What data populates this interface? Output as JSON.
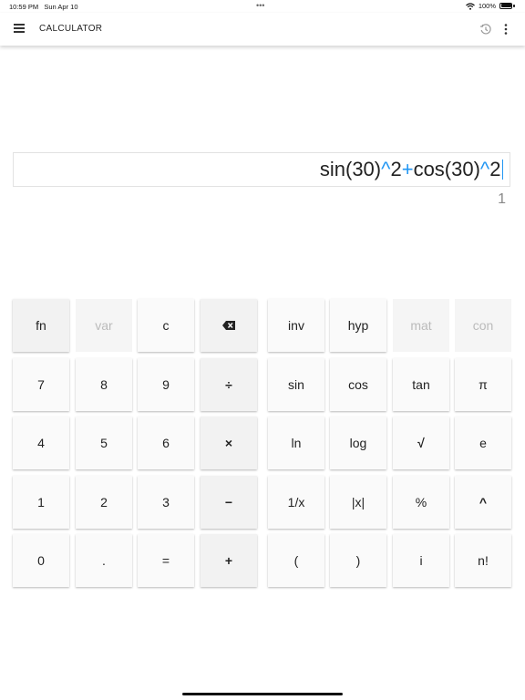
{
  "status_bar": {
    "time": "10:59 PM",
    "date": "Sun Apr 10",
    "dots": "•••",
    "battery": "100%"
  },
  "app_bar": {
    "title": "CALCULATOR",
    "icons": [
      "menu-icon",
      "history-icon",
      "more-vert-icon"
    ]
  },
  "display": {
    "expression": {
      "p1": "sin(30)",
      "op1": "^",
      "p2": "2",
      "op2": "+",
      "p3": "cos(30)",
      "op3": "^",
      "p4": "2"
    },
    "result": "1"
  },
  "keypad": {
    "left": [
      [
        {
          "label": "fn"
        },
        {
          "label": "var"
        },
        {
          "label": "c"
        },
        {
          "label": "",
          "icon": "backspace-icon"
        }
      ],
      [
        {
          "label": "7"
        },
        {
          "label": "8"
        },
        {
          "label": "9"
        },
        {
          "label": "÷"
        }
      ],
      [
        {
          "label": "4"
        },
        {
          "label": "5"
        },
        {
          "label": "6"
        },
        {
          "label": "×"
        }
      ],
      [
        {
          "label": "1"
        },
        {
          "label": "2"
        },
        {
          "label": "3"
        },
        {
          "label": "−"
        }
      ],
      [
        {
          "label": "0"
        },
        {
          "label": "."
        },
        {
          "label": "="
        },
        {
          "label": "+"
        }
      ]
    ],
    "right": [
      [
        {
          "label": "inv"
        },
        {
          "label": "hyp"
        },
        {
          "label": "mat"
        },
        {
          "label": "con"
        }
      ],
      [
        {
          "label": "sin"
        },
        {
          "label": "cos"
        },
        {
          "label": "tan"
        },
        {
          "label": "π"
        }
      ],
      [
        {
          "label": "ln"
        },
        {
          "label": "log"
        },
        {
          "label": "√"
        },
        {
          "label": "e"
        }
      ],
      [
        {
          "label": "1/x"
        },
        {
          "label": "|x|"
        },
        {
          "label": "%"
        },
        {
          "label": "^"
        }
      ],
      [
        {
          "label": "("
        },
        {
          "label": ")"
        },
        {
          "label": "i"
        },
        {
          "label": "n!"
        }
      ]
    ]
  },
  "colors": {
    "accent": "#2196f3",
    "key_bg": "#fafafa",
    "key_gray_bg": "#f2f2f2",
    "disabled_text": "#bbbbbb"
  }
}
